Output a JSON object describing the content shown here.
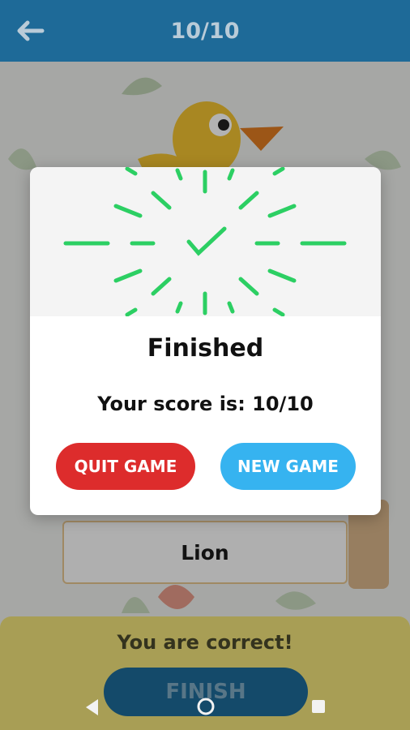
{
  "header": {
    "back_icon": "arrow-left-icon",
    "progress": "10/10"
  },
  "quiz": {
    "answer": "Lion",
    "feedback": "You are correct!",
    "finish_label": "FINISH"
  },
  "dialog": {
    "success_icon": "checkmark-burst-icon",
    "title": "Finished",
    "score_text": "Your score is: 10/10",
    "quit_label": "QUIT GAME",
    "new_label": "NEW GAME"
  },
  "navbar": {
    "back_icon": "nav-back-icon",
    "home_icon": "nav-home-icon",
    "recent_icon": "nav-recent-icon"
  },
  "colors": {
    "header_bg": "#1e6a98",
    "success_green": "#2ccf63",
    "quit_red": "#dd2c2c",
    "new_blue": "#36b3f0",
    "feedback_yellow": "#f1e27a"
  }
}
